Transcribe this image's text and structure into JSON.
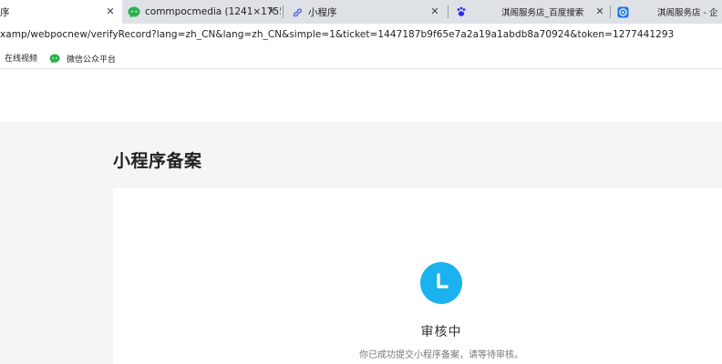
{
  "tabs": [
    {
      "title": "序",
      "active": true
    },
    {
      "title": "commpocmedia (1241×1755)",
      "icon": "wechat-icon"
    },
    {
      "title": "小程序",
      "icon": "miniprogram-icon"
    },
    {
      "title": "",
      "icon": "baidu-paw-icon"
    },
    {
      "title": "淇阁服务店_百度搜索"
    },
    {
      "title": "淇阁服务店 - 企",
      "icon": "browser-globe-icon"
    }
  ],
  "address_bar": {
    "url": "xamp/webpocnew/verifyRecord?lang=zh_CN&lang=zh_CN&simple=1&ticket=1447187b9f65e7a2a19a1abdb8a70924&token=1277441293"
  },
  "bookmarks": [
    {
      "label": "在线视频"
    },
    {
      "label": "微信公众平台",
      "icon": "wechat-icon"
    }
  ],
  "page": {
    "title": "小程序备案",
    "status_icon": "clock-icon",
    "status_title": "审核中",
    "status_desc": "你已成功提交小程序备案，请等待审核。",
    "accent_color": "#1ab2ef"
  }
}
